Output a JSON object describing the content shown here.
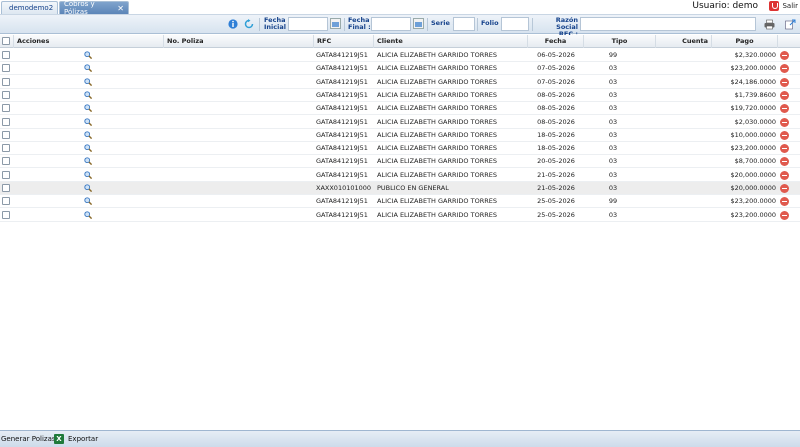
{
  "tabs": [
    {
      "label": "demodemo2",
      "icon": "home-icon"
    },
    {
      "label": "Cobros y Pólizas",
      "close": "✕"
    }
  ],
  "user": {
    "label": "Usuario: demo",
    "logout_label": "Salir"
  },
  "toolbar": {
    "fecha_inicial_label_1": "Fecha",
    "fecha_inicial_label_2": "Inicial :",
    "fecha_final_label_1": "Fecha",
    "fecha_final_label_2": "Final :",
    "serie_label": "Serie :",
    "folio_label": "Folio",
    "razon_label_1": "Razón Social",
    "razon_label_2": "RFC :",
    "fecha_inicial_value": "",
    "fecha_final_value": "",
    "serie_value": "",
    "folio_value": "",
    "razon_value": ""
  },
  "columns": [
    "Acciones",
    "No. Poliza",
    "RFC",
    "Cliente",
    "Fecha",
    "Tipo",
    "Cuenta",
    "Pago"
  ],
  "rows": [
    {
      "rfc": "GATA841219J51",
      "cliente": "ALICIA ELIZABETH GARRIDO TORRES",
      "fecha": "06-05-2026",
      "tipo": "99",
      "cuenta": "",
      "pago": "$2,320.0000"
    },
    {
      "rfc": "GATA841219J51",
      "cliente": "ALICIA ELIZABETH GARRIDO TORRES",
      "fecha": "07-05-2026",
      "tipo": "03",
      "cuenta": "",
      "pago": "$23,200.0000"
    },
    {
      "rfc": "GATA841219J51",
      "cliente": "ALICIA ELIZABETH GARRIDO TORRES",
      "fecha": "07-05-2026",
      "tipo": "03",
      "cuenta": "",
      "pago": "$24,186.0000"
    },
    {
      "rfc": "GATA841219J51",
      "cliente": "ALICIA ELIZABETH GARRIDO TORRES",
      "fecha": "08-05-2026",
      "tipo": "03",
      "cuenta": "",
      "pago": "$1,739.8600"
    },
    {
      "rfc": "GATA841219J51",
      "cliente": "ALICIA ELIZABETH GARRIDO TORRES",
      "fecha": "08-05-2026",
      "tipo": "03",
      "cuenta": "",
      "pago": "$19,720.0000"
    },
    {
      "rfc": "GATA841219J51",
      "cliente": "ALICIA ELIZABETH GARRIDO TORRES",
      "fecha": "08-05-2026",
      "tipo": "03",
      "cuenta": "",
      "pago": "$2,030.0000"
    },
    {
      "rfc": "GATA841219J51",
      "cliente": "ALICIA ELIZABETH GARRIDO TORRES",
      "fecha": "18-05-2026",
      "tipo": "03",
      "cuenta": "",
      "pago": "$10,000.0000"
    },
    {
      "rfc": "GATA841219J51",
      "cliente": "ALICIA ELIZABETH GARRIDO TORRES",
      "fecha": "18-05-2026",
      "tipo": "03",
      "cuenta": "",
      "pago": "$23,200.0000"
    },
    {
      "rfc": "GATA841219J51",
      "cliente": "ALICIA ELIZABETH GARRIDO TORRES",
      "fecha": "20-05-2026",
      "tipo": "03",
      "cuenta": "",
      "pago": "$8,700.0000"
    },
    {
      "rfc": "GATA841219J51",
      "cliente": "ALICIA ELIZABETH GARRIDO TORRES",
      "fecha": "21-05-2026",
      "tipo": "03",
      "cuenta": "",
      "pago": "$20,000.0000"
    },
    {
      "rfc": "XAXX010101000",
      "cliente": "PUBLICO EN GENERAL",
      "fecha": "21-05-2026",
      "tipo": "03",
      "cuenta": "",
      "pago": "$20,000.0000"
    },
    {
      "rfc": "GATA841219J51",
      "cliente": "ALICIA ELIZABETH GARRIDO TORRES",
      "fecha": "25-05-2026",
      "tipo": "99",
      "cuenta": "",
      "pago": "$23,200.0000"
    },
    {
      "rfc": "GATA841219J51",
      "cliente": "ALICIA ELIZABETH GARRIDO TORRES",
      "fecha": "25-05-2026",
      "tipo": "03",
      "cuenta": "",
      "pago": "$23,200.0000"
    }
  ],
  "footer": {
    "generar_label": "Generar Polizas",
    "exportar_label": "Exportar"
  }
}
